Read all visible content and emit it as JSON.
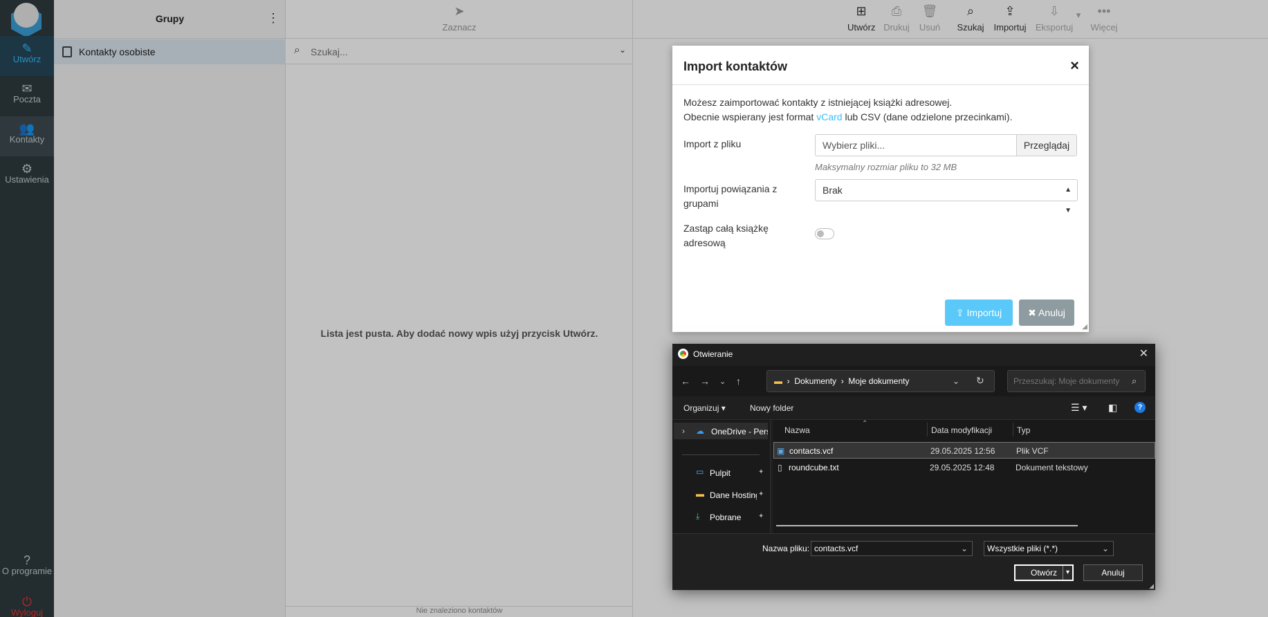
{
  "rail": {
    "items": [
      {
        "label": "Utwórz",
        "icon": "compose-icon"
      },
      {
        "label": "Poczta",
        "icon": "mail-icon"
      },
      {
        "label": "Kontakty",
        "icon": "contacts-icon"
      },
      {
        "label": "Ustawienia",
        "icon": "gear-icon"
      }
    ],
    "about": "O programie",
    "logout": "Wyloguj"
  },
  "groups": {
    "title": "Grupy",
    "items": [
      "Kontakty osobiste"
    ]
  },
  "list": {
    "select_label": "Zaznacz",
    "search_placeholder": "Szukaj...",
    "empty_message": "Lista jest pusta. Aby dodać nowy wpis użyj przycisk Utwórz.",
    "footer": "Nie znaleziono kontaktów"
  },
  "toolbar": {
    "create": "Utwórz",
    "print": "Drukuj",
    "delete": "Usuń",
    "search": "Szukaj",
    "import": "Importuj",
    "export": "Eksportuj",
    "more": "Więcej"
  },
  "import_dialog": {
    "title": "Import kontaktów",
    "intro_line1": "Możesz zaimportować kontakty z istniejącej książki adresowej.",
    "intro_line2_prefix": "Obecnie wspierany jest format ",
    "intro_link": "vCard",
    "intro_line2_suffix": " lub CSV (dane odzielone przecinkami).",
    "file_label": "Import z pliku",
    "file_placeholder": "Wybierz pliki...",
    "browse_label": "Przeglądaj",
    "size_hint": "Maksymalny rozmiar pliku to 32 MB",
    "groups_label_1": "Importuj powiązania z",
    "groups_label_2": "grupami",
    "groups_value": "Brak",
    "replace_label_1": "Zastąp całą książkę",
    "replace_label_2": "adresową",
    "replace_enabled": false,
    "import_button": "Importuj",
    "cancel_button": "Anuluj",
    "link_color": "#37beff"
  },
  "file_dialog": {
    "title": "Otwieranie",
    "path": [
      "Dokumenty",
      "Moje dokumenty"
    ],
    "search_placeholder": "Przeszukaj: Moje dokumenty",
    "organize": "Organizuj",
    "new_folder": "Nowy folder",
    "sidebar": [
      {
        "label": "OneDrive - Perso",
        "icon": "cloud-icon"
      },
      {
        "label": "Pulpit",
        "icon": "desktop-icon"
      },
      {
        "label": "Dane Hosting",
        "icon": "folder-icon"
      },
      {
        "label": "Pobrane",
        "icon": "download-icon"
      }
    ],
    "columns": [
      "Nazwa",
      "Data modyfikacji",
      "Typ"
    ],
    "files": [
      {
        "name": "contacts.vcf",
        "date": "29.05.2025 12:56",
        "type": "Plik VCF",
        "selected": true
      },
      {
        "name": "roundcube.txt",
        "date": "29.05.2025 12:48",
        "type": "Dokument tekstowy",
        "selected": false
      }
    ],
    "filename_label": "Nazwa pliku:",
    "filename_value": "contacts.vcf",
    "filetype_value": "Wszystkie pliki (*.*)",
    "open_button": "Otwórz",
    "cancel_button": "Anuluj"
  }
}
